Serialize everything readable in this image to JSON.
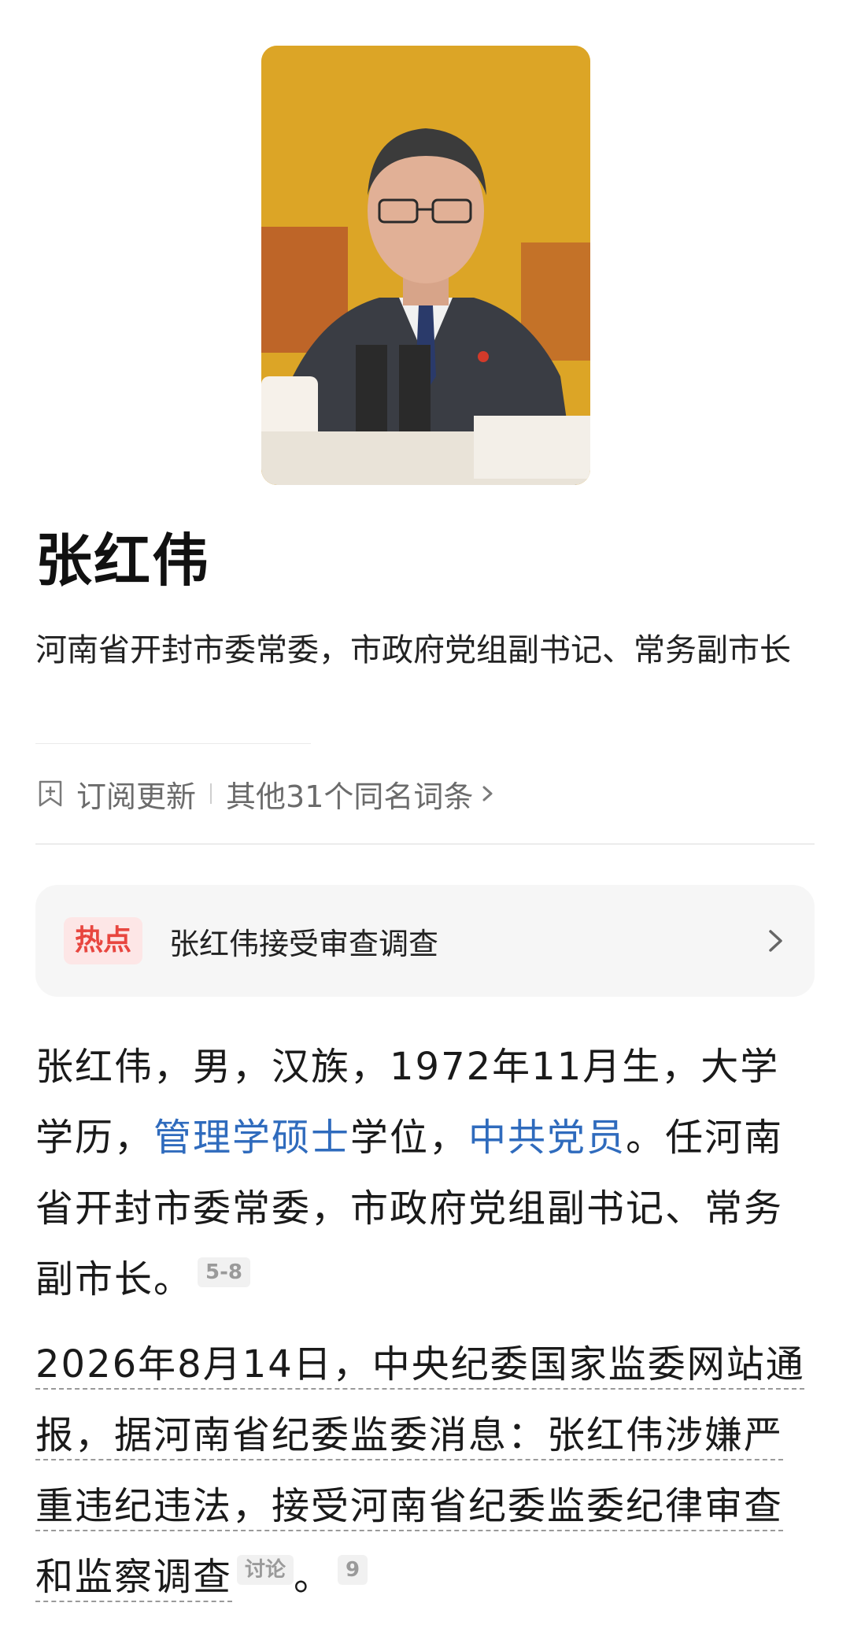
{
  "profile": {
    "name": "张红伟",
    "description": "河南省开封市委常委，市政府党组副书记、常务副市长"
  },
  "actions": {
    "subscribe_label": "订阅更新",
    "other_entries_label": "其他31个同名词条"
  },
  "hot_topic": {
    "badge": "热点",
    "text": "张红伟接受审查调查"
  },
  "paragraph1": {
    "t1": "张红伟，男，汉族，1972年11月生，大学学历，",
    "link1": "管理学硕士",
    "t2": "学位，",
    "link2": "中共党员",
    "t3": "。任河南省开封市委常委，市政府党组副书记、常务副市长。",
    "ref": "5-8"
  },
  "paragraph2": {
    "text": "2026年8月14日，中央纪委国家监委网站通报，据河南省纪委监委消息：张红伟涉嫌严重违纪违法，接受河南省纪委监委纪律审查和监察调查",
    "discuss_tag": "讨论",
    "end_punct": "。",
    "ref": "9"
  },
  "colors": {
    "link": "#2f6bbd",
    "hot_badge_text": "#e8463f",
    "hot_badge_bg": "#fde6e6"
  }
}
